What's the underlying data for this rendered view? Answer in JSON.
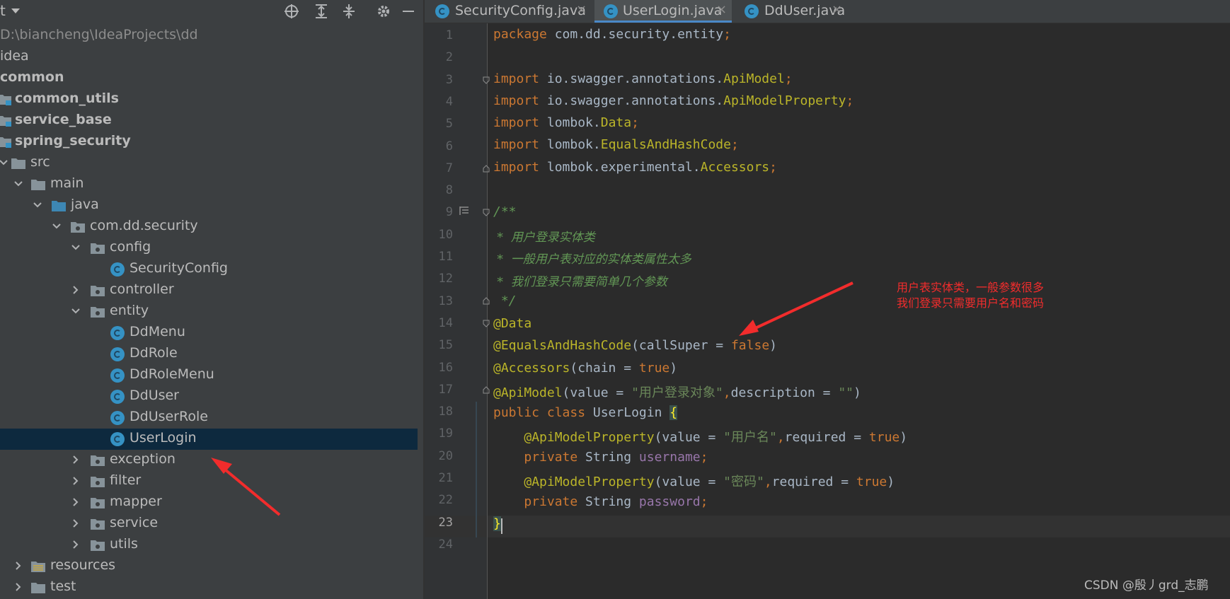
{
  "project_toolbar": {
    "title_fragment": "t",
    "icons": [
      "locate-icon",
      "expand-all-icon",
      "collapse-all-icon",
      "gear-icon",
      "minimize-icon"
    ]
  },
  "tree": [
    {
      "label": "D:\\biancheng\\IdeaProjects\\dd",
      "kind": "path"
    },
    {
      "label": "idea",
      "kind": "plain"
    },
    {
      "label": "common",
      "kind": "bold"
    },
    {
      "label": "common_utils",
      "kind": "bold-module"
    },
    {
      "label": "service_base",
      "kind": "bold-module"
    },
    {
      "label": "spring_security",
      "kind": "bold-module"
    },
    {
      "label": "src",
      "kind": "folder",
      "expanded": true
    },
    {
      "label": "main",
      "kind": "folder",
      "expanded": true
    },
    {
      "label": "java",
      "kind": "source-folder",
      "expanded": true
    },
    {
      "label": "com.dd.security",
      "kind": "package",
      "expanded": true
    },
    {
      "label": "config",
      "kind": "package",
      "expanded": true
    },
    {
      "label": "SecurityConfig",
      "kind": "class"
    },
    {
      "label": "controller",
      "kind": "package",
      "expanded": false
    },
    {
      "label": "entity",
      "kind": "package",
      "expanded": true
    },
    {
      "label": "DdMenu",
      "kind": "class"
    },
    {
      "label": "DdRole",
      "kind": "class"
    },
    {
      "label": "DdRoleMenu",
      "kind": "class"
    },
    {
      "label": "DdUser",
      "kind": "class"
    },
    {
      "label": "DdUserRole",
      "kind": "class"
    },
    {
      "label": "UserLogin",
      "kind": "class",
      "selected": true
    },
    {
      "label": "exception",
      "kind": "package",
      "expanded": false
    },
    {
      "label": "filter",
      "kind": "package",
      "expanded": false
    },
    {
      "label": "mapper",
      "kind": "package",
      "expanded": false
    },
    {
      "label": "service",
      "kind": "package",
      "expanded": false
    },
    {
      "label": "utils",
      "kind": "package",
      "expanded": false
    },
    {
      "label": "resources",
      "kind": "resources",
      "expanded": false
    },
    {
      "label": "test",
      "kind": "folder",
      "expanded": false
    }
  ],
  "tabs": [
    {
      "label": "SecurityConfig.java",
      "active": false
    },
    {
      "label": "UserLogin.java",
      "active": true
    },
    {
      "label": "DdUser.java",
      "active": false
    }
  ],
  "tab_close_glyph": "×",
  "line_numbers": [
    "1",
    "2",
    "3",
    "4",
    "5",
    "6",
    "7",
    "8",
    "9",
    "10",
    "11",
    "12",
    "13",
    "14",
    "15",
    "16",
    "17",
    "18",
    "19",
    "20",
    "21",
    "22",
    "23",
    "24"
  ],
  "current_line": "23",
  "code": {
    "l1_kw": "package",
    "l1_rest": " com.dd.security.entity",
    "l1_semi": ";",
    "import_kw": "import",
    "l3_pkg": " io.swagger.annotations.",
    "l3_cls": "ApiModel",
    "l4_pkg": " io.swagger.annotations.",
    "l4_cls": "ApiModelProperty",
    "l5_pkg": " lombok.",
    "l5_cls": "Data",
    "l6_pkg": " lombok.",
    "l6_cls": "EqualsAndHashCode",
    "l7_pkg": " lombok.experimental.",
    "l7_cls": "Accessors",
    "semi": ";",
    "l9": "/**",
    "l10": " *  用户登录实体类",
    "l11": " *  一般用户表对应的实体类属性太多",
    "l12": " *  我们登录只需要简单几个参数",
    "l13": " */",
    "l14": "@Data",
    "l15_an": "@EqualsAndHashCode",
    "l15_a": "(callSuper = ",
    "l15_b": "false",
    "l15_c": ")",
    "l16_an": "@Accessors",
    "l16_a": "(chain = ",
    "l16_b": "true",
    "l16_c": ")",
    "l17_an": "@ApiModel",
    "l17_a": "(value = ",
    "l17_s1": "\"用户登录对象\"",
    "l17_comma": ",",
    "l17_b": "description = ",
    "l17_s2": "\"\"",
    "l17_c": ")",
    "l18_kw": "public class",
    "l18_name": " UserLogin ",
    "l18_brace": "{",
    "l19_an": "@ApiModelProperty",
    "l19_a": "(value = ",
    "l19_s": "\"用户名\"",
    "l19_comma": ",",
    "l19_b": "required = ",
    "l19_t": "true",
    "l19_c": ")",
    "l20_kw": "private",
    "l20_type": " String ",
    "l20_field": "username",
    "l21_an": "@ApiModelProperty",
    "l21_a": "(value = ",
    "l21_s": "\"密码\"",
    "l21_comma": ",",
    "l21_b": "required = ",
    "l21_t": "true",
    "l21_c": ")",
    "l22_kw": "private",
    "l22_type": " String ",
    "l22_field": "password",
    "l23": "}"
  },
  "annotation_note": [
    "用户表实体类，一般参数很多",
    "我们登录只需要用户名和密码"
  ],
  "watermark": "CSDN @殷丿grd_志鹏",
  "colors": {
    "annotation_red": "#f22c2c",
    "selection": "#0d293e",
    "tab_underline": "#4a88c7",
    "class_icon": "#3592c4"
  }
}
